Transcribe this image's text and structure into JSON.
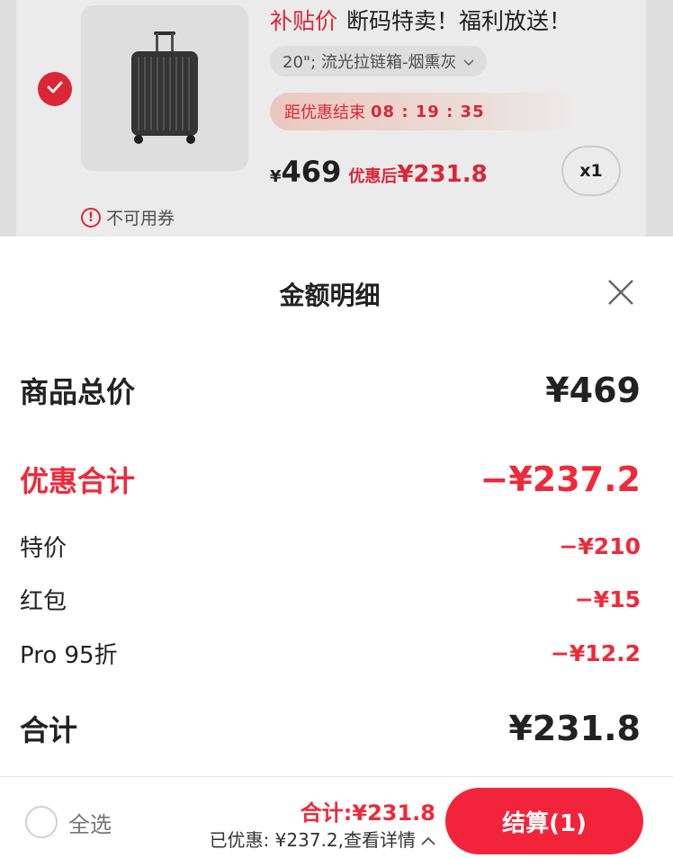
{
  "product": {
    "title_tag": "补贴价",
    "title_text": "断码特卖！福利放送！",
    "spec": "20\"; 流光拉链箱-烟熏灰",
    "countdown_label": "距优惠结束",
    "countdown_time": "08 : 19 : 35",
    "price_symbol": "¥",
    "price": "469",
    "after_label": "优惠后",
    "after_price": "¥231.8",
    "quantity": "x1",
    "coupon_note": "不可用券",
    "warn_glyph": "!",
    "selected": true
  },
  "sheet": {
    "title": "金额明细",
    "rows": [
      {
        "label": "商品总价",
        "value": "¥469"
      },
      {
        "label": "优惠合计",
        "value": "−¥237.2"
      },
      {
        "label": "特价",
        "value": "−¥210"
      },
      {
        "label": "红包",
        "value": "−¥15"
      },
      {
        "label": "Pro 95折",
        "value": "−¥12.2"
      },
      {
        "label": "合计",
        "value": "¥231.8"
      }
    ]
  },
  "bottom": {
    "select_all_label": "全选",
    "total_text": "合计:¥231.8",
    "saved_text": "已优惠: ¥237.2,查看详情",
    "checkout_label": "结算(1)"
  },
  "colors": {
    "accent": "#ee2a3a",
    "checkout": "#f2243b"
  }
}
